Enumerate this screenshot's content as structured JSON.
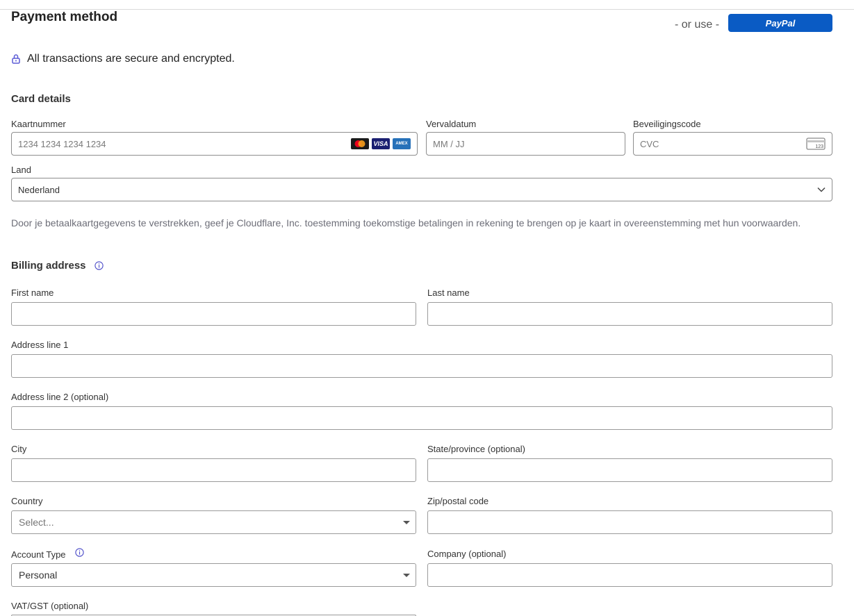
{
  "header": {
    "title": "Payment method",
    "or_use": "- or use -",
    "paypal_label": "PayPal",
    "secure_text": "All transactions are secure and encrypted."
  },
  "card": {
    "heading": "Card details",
    "number_label": "Kaartnummer",
    "number_placeholder": "1234 1234 1234 1234",
    "expiry_label": "Vervaldatum",
    "expiry_placeholder": "MM / JJ",
    "cvc_label": "Beveiligingscode",
    "cvc_placeholder": "CVC",
    "cvc_icon_text": "123",
    "visa_text": "VISA",
    "amex_text": "AMEX",
    "country_label": "Land",
    "country_value": "Nederland",
    "consent": "Door je betaalkaartgegevens te verstrekken, geef je Cloudflare, Inc. toestemming toekomstige betalingen in rekening te brengen op je kaart in overeenstemming met hun voorwaarden."
  },
  "billing": {
    "heading": "Billing address",
    "first_name_label": "First name",
    "last_name_label": "Last name",
    "address1_label": "Address line 1",
    "address2_label": "Address line 2 (optional)",
    "city_label": "City",
    "state_label": "State/province (optional)",
    "country_label": "Country",
    "country_placeholder": "Select...",
    "zip_label": "Zip/postal code",
    "account_type_label": "Account Type",
    "account_type_value": "Personal",
    "company_label": "Company (optional)",
    "vat_label": "VAT/GST (optional)"
  },
  "colors": {
    "paypal_blue": "#0a5bc4",
    "lock_icon": "#5b5bd6"
  }
}
